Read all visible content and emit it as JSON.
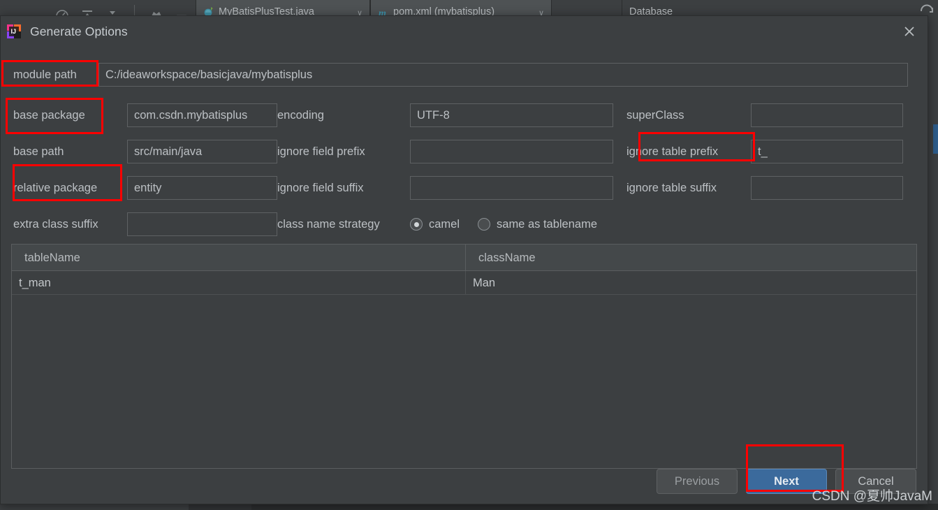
{
  "ide": {
    "toolbar_icons": [
      "gauge-icon",
      "collapse-all-icon",
      "expand-all-icon",
      "separator",
      "settings-star-icon",
      "minimize-icon"
    ],
    "tabs": [
      {
        "label": "MyBatisPlusTest.java",
        "icon": "java-file-icon",
        "caret": "∨"
      },
      {
        "label": "pom.xml (mybatisplus)",
        "icon": "maven-file-icon",
        "caret": "∨"
      },
      {
        "label": "",
        "icon": ""
      },
      {
        "label": "Database",
        "icon": ""
      }
    ],
    "sync_icon": "sync-icon"
  },
  "dialog": {
    "title": "Generate Options",
    "logo": "intellij-idea-logo",
    "close_icon": "close-icon",
    "module_path": {
      "label": "module path",
      "value": "C:/ideaworkspace/basicjava/mybatisplus",
      "placeholder": ""
    },
    "fields": {
      "base_package": {
        "label": "base package",
        "value": "com.csdn.mybatisplus",
        "placeholder": ""
      },
      "base_path": {
        "label": "base path",
        "value": "src/main/java",
        "placeholder": ""
      },
      "relative_package": {
        "label": "relative package",
        "value": "entity",
        "placeholder": ""
      },
      "extra_class_suffix": {
        "label": "extra class suffix",
        "value": "",
        "placeholder": ""
      },
      "encoding": {
        "label": "encoding",
        "value": "UTF-8",
        "placeholder": ""
      },
      "ignore_field_prefix": {
        "label": "ignore field prefix",
        "value": "",
        "placeholder": ""
      },
      "ignore_field_suffix": {
        "label": "ignore field suffix",
        "value": "",
        "placeholder": ""
      },
      "super_class": {
        "label": "superClass",
        "value": "",
        "placeholder": ""
      },
      "ignore_table_prefix": {
        "label": "ignore table prefix",
        "value": "t_",
        "placeholder": ""
      },
      "ignore_table_suffix": {
        "label": "ignore table suffix",
        "value": "",
        "placeholder": ""
      },
      "class_name_strategy": {
        "label": "class name strategy",
        "selected": "camel",
        "options": [
          "camel",
          "same as tablename"
        ]
      }
    },
    "table": {
      "columns": [
        "tableName",
        "className"
      ],
      "rows": [
        {
          "tableName": "t_man",
          "className": "Man"
        }
      ]
    },
    "buttons": {
      "previous": "Previous",
      "next": "Next",
      "cancel": "Cancel"
    }
  },
  "annotations": {
    "highlight_color": "#ff0000",
    "boxes": [
      "module-path-label",
      "base-package-label",
      "relative-package-label",
      "ignore-table-prefix-label",
      "next-button"
    ]
  },
  "watermark": "CSDN @夏帅JavaM"
}
